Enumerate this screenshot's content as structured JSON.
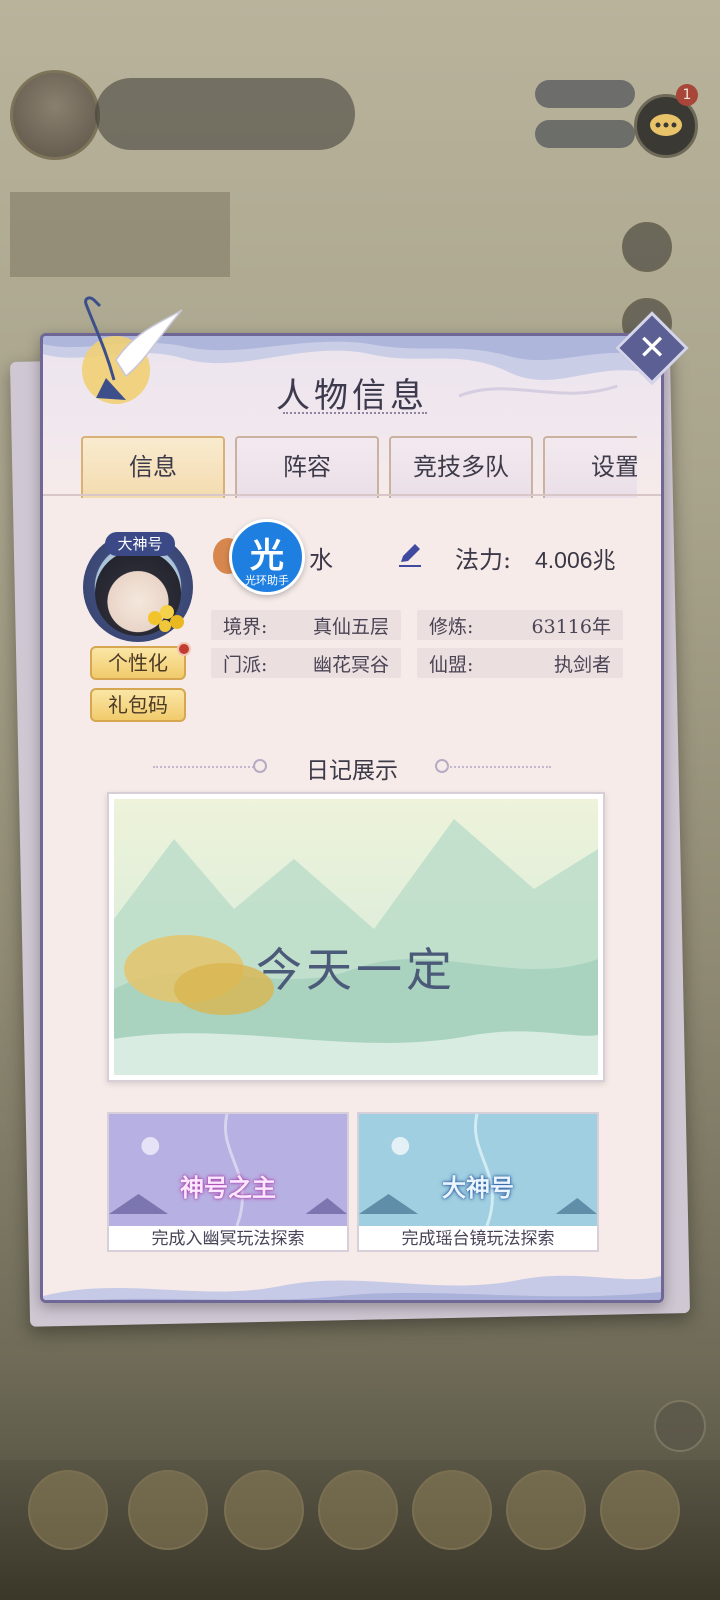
{
  "background": {
    "player_name": "",
    "player_power": "",
    "chat_badge": "1"
  },
  "panel": {
    "title": "人物信息",
    "tabs": [
      {
        "label": "信息",
        "active": true
      },
      {
        "label": "阵容",
        "active": false
      },
      {
        "label": "竞技多队",
        "active": false
      },
      {
        "label": "设置",
        "active": false
      }
    ]
  },
  "profile": {
    "avatar_tag": "大神号",
    "name": "水",
    "power_label": "法力:",
    "power_value": "4.006兆",
    "personalize_label": "个性化",
    "giftcode_label": "礼包码",
    "stats": [
      {
        "key": "境界:",
        "value": "真仙五层"
      },
      {
        "key": "修炼:",
        "value": "63116年"
      },
      {
        "key": "门派:",
        "value": "幽花冥谷"
      },
      {
        "key": "仙盟:",
        "value": "执剑者"
      }
    ]
  },
  "watermark": {
    "char": "光",
    "text": "光环助手"
  },
  "diary": {
    "section_title": "日记展示",
    "text": "今天一定"
  },
  "achievements": [
    {
      "title": "神号之主",
      "caption": "完成入幽冥玩法探索"
    },
    {
      "title": "大神号",
      "caption": "完成瑶台镜玩法探索"
    }
  ],
  "colors": {
    "panel_bg": "#f6ebe9",
    "panel_border": "#6f6796",
    "active_tab": "#f3dbaf",
    "close_button": "#5b5f93",
    "gold_button": "#f1cb6b"
  },
  "icons": [
    "crane-icon",
    "close-icon",
    "edit-icon",
    "chat-icon"
  ]
}
